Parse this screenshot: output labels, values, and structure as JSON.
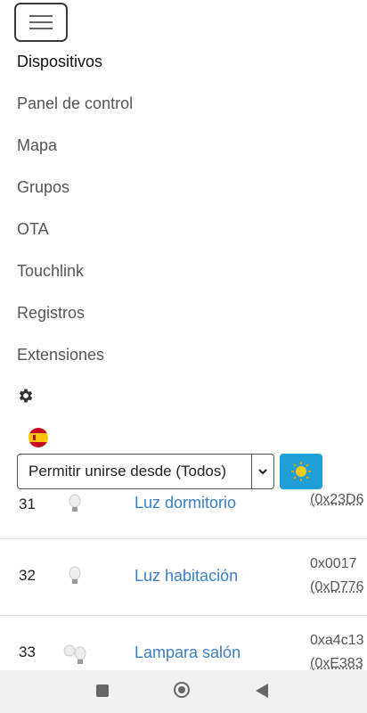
{
  "nav": {
    "items": [
      {
        "label": "Dispositivos",
        "active": true
      },
      {
        "label": "Panel de control"
      },
      {
        "label": "Mapa"
      },
      {
        "label": "Grupos"
      },
      {
        "label": "OTA"
      },
      {
        "label": "Touchlink"
      },
      {
        "label": "Registros"
      },
      {
        "label": "Extensiones"
      }
    ],
    "icons": {
      "menu": "hamburger-icon",
      "settings": "gear-icon",
      "language": "spain-flag-icon"
    }
  },
  "permit_join": {
    "label": "Permitir unirse desde (Todos)",
    "theme_icon": "sun-icon"
  },
  "devices": {
    "rows": [
      {
        "id": "31",
        "name": "Luz dormitorio",
        "ieee": "",
        "nwk": "(0x23D6"
      },
      {
        "id": "32",
        "name": "Luz habitación",
        "ieee": "0x0017",
        "nwk": "(0xD776"
      },
      {
        "id": "33",
        "name": "Lampara salón",
        "ieee": "0xa4c13",
        "nwk": "(0xE383"
      }
    ]
  },
  "colors": {
    "link": "#3b7fc4",
    "accent": "#1f9fd8"
  }
}
